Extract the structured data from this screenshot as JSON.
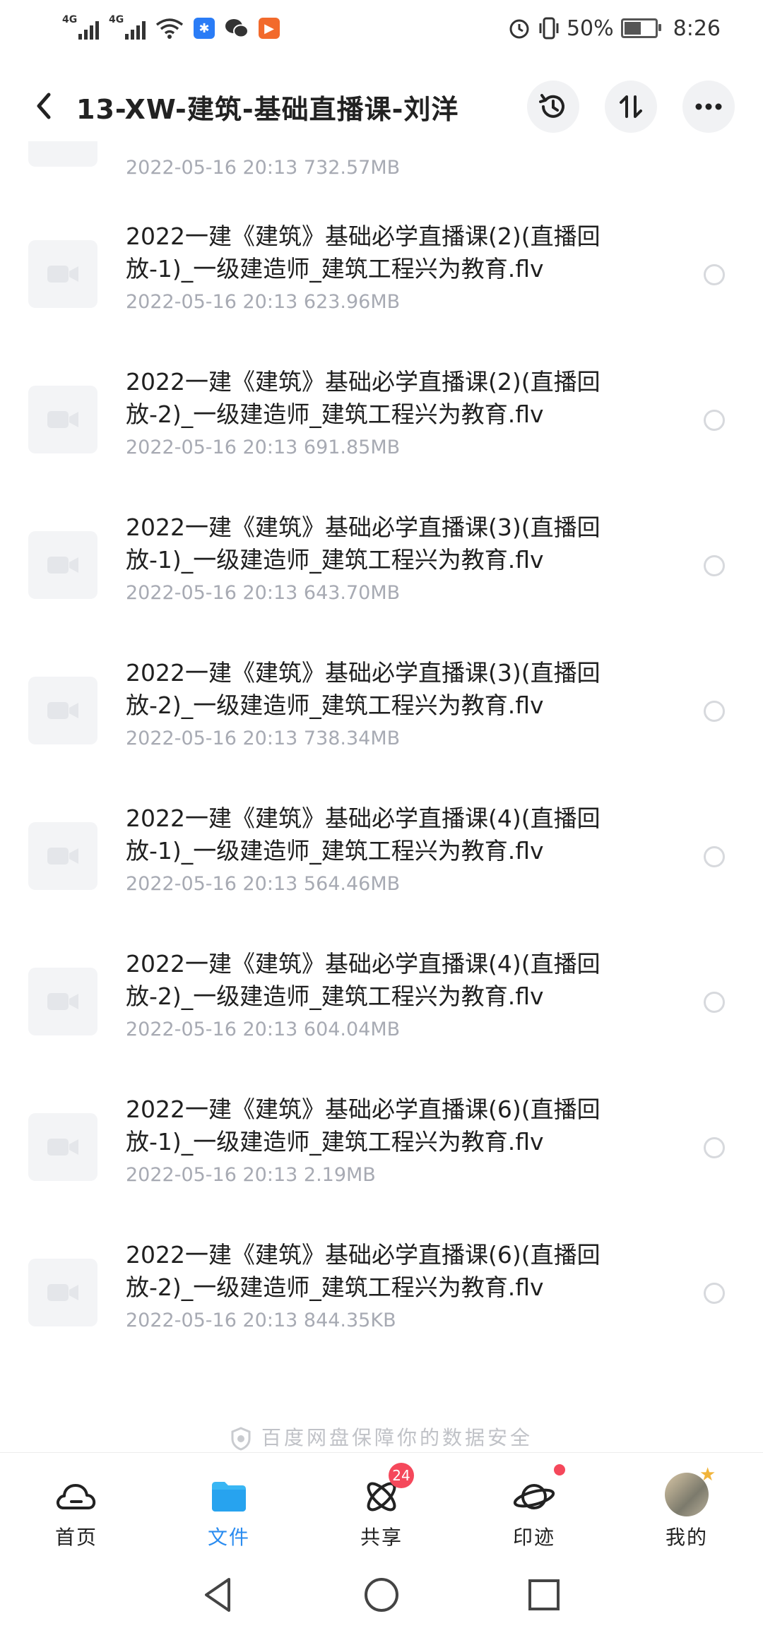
{
  "status_bar": {
    "network1": "4G",
    "network2": "4G",
    "battery": "50%",
    "time": "8:26",
    "icons": [
      "signal-icon",
      "signal-icon",
      "wifi-icon",
      "app-notification-icon",
      "wechat-icon",
      "video-app-icon",
      "alarm-icon",
      "vibrate-icon",
      "battery-icon"
    ]
  },
  "header": {
    "title": "13-XW-建筑-基础直播课-刘洋",
    "icons": [
      "back-icon",
      "history-icon",
      "sort-icon",
      "more-icon"
    ]
  },
  "partial_row": {
    "meta": "2022-05-16  20:13  732.57MB"
  },
  "files": [
    {
      "name": "2022一建《建筑》基础必学直播课(2)(直播回放-1)_一级建造师_建筑工程兴为教育.flv",
      "meta": "2022-05-16  20:13  623.96MB"
    },
    {
      "name": "2022一建《建筑》基础必学直播课(2)(直播回放-2)_一级建造师_建筑工程兴为教育.flv",
      "meta": "2022-05-16  20:13  691.85MB"
    },
    {
      "name": "2022一建《建筑》基础必学直播课(3)(直播回放-1)_一级建造师_建筑工程兴为教育.flv",
      "meta": "2022-05-16  20:13  643.70MB"
    },
    {
      "name": "2022一建《建筑》基础必学直播课(3)(直播回放-2)_一级建造师_建筑工程兴为教育.flv",
      "meta": "2022-05-16  20:13  738.34MB"
    },
    {
      "name": "2022一建《建筑》基础必学直播课(4)(直播回放-1)_一级建造师_建筑工程兴为教育.flv",
      "meta": "2022-05-16  20:13  564.46MB"
    },
    {
      "name": "2022一建《建筑》基础必学直播课(4)(直播回放-2)_一级建造师_建筑工程兴为教育.flv",
      "meta": "2022-05-16  20:13  604.04MB"
    },
    {
      "name": "2022一建《建筑》基础必学直播课(6)(直播回放-1)_一级建造师_建筑工程兴为教育.flv",
      "meta": "2022-05-16  20:13  2.19MB"
    },
    {
      "name": "2022一建《建筑》基础必学直播课(6)(直播回放-2)_一级建造师_建筑工程兴为教育.flv",
      "meta": "2022-05-16  20:13  844.35KB"
    }
  ],
  "footer_note": "百度网盘保障你的数据安全",
  "bottom_nav": [
    {
      "label": "首页",
      "icon": "home-cloud-icon"
    },
    {
      "label": "文件",
      "icon": "folder-icon",
      "active": true
    },
    {
      "label": "共享",
      "icon": "share-atom-icon",
      "badge": "24"
    },
    {
      "label": "印迹",
      "icon": "planet-icon",
      "dot": true
    },
    {
      "label": "我的",
      "icon": "avatar-icon"
    }
  ],
  "colors": {
    "accent": "#2a8cf0",
    "badge": "#f5485b",
    "meta": "#a7aab3"
  }
}
